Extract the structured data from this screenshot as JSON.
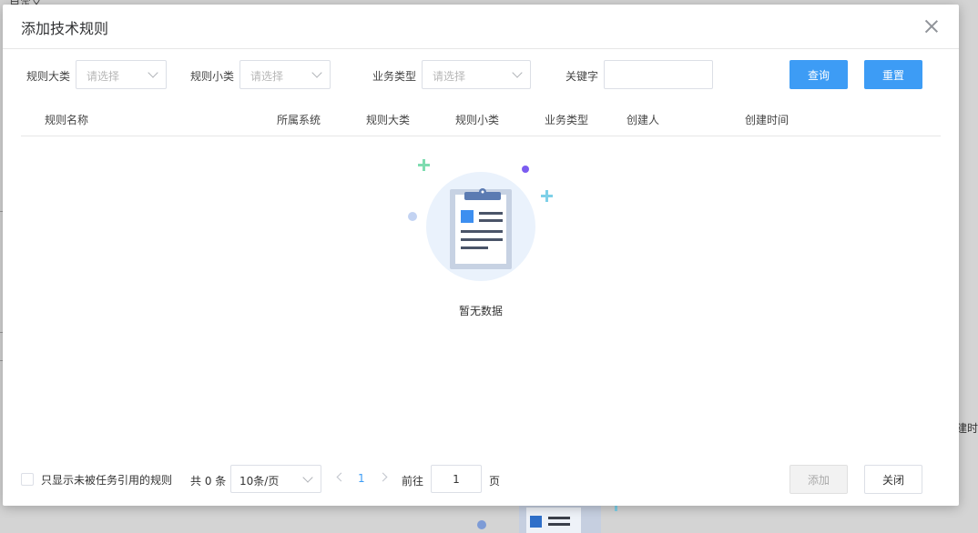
{
  "background": {
    "top_text": "自定义",
    "right_text": "创建时"
  },
  "modal": {
    "title": "添加技术规则",
    "close_icon": "close-icon"
  },
  "filters": {
    "rule_major_label": "规则大类",
    "rule_major_placeholder": "请选择",
    "rule_minor_label": "规则小类",
    "rule_minor_placeholder": "请选择",
    "biz_type_label": "业务类型",
    "biz_type_placeholder": "请选择",
    "keyword_label": "关键字",
    "keyword_value": "",
    "search_label": "查询",
    "reset_label": "重置"
  },
  "table": {
    "columns": [
      "规则名称",
      "所属系统",
      "规则大类",
      "规则小类",
      "业务类型",
      "创建人",
      "创建时间"
    ],
    "rows": [],
    "empty_text": "暂无数据"
  },
  "footer": {
    "only_unreferenced_label": "只显示未被任务引用的规则",
    "only_unreferenced_checked": false,
    "total_text": "共 0 条",
    "page_size_value": "10条/页",
    "current_page": "1",
    "goto_label": "前往",
    "goto_value": "1",
    "goto_unit": "页",
    "add_label": "添加",
    "close_label": "关闭"
  },
  "colors": {
    "primary": "#3d9cf5",
    "border": "#dcdfe6",
    "placeholder": "#b7b7b7"
  }
}
